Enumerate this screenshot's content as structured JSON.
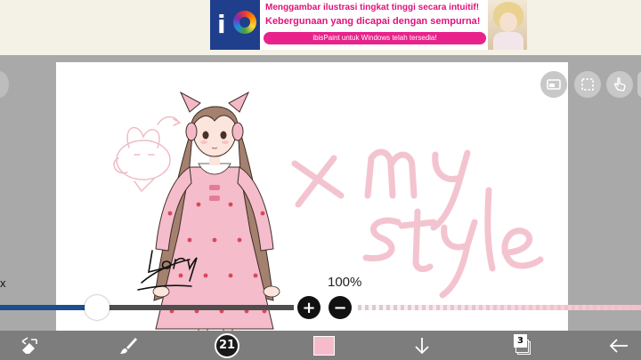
{
  "ad": {
    "logo_text": "i",
    "line1": "Menggambar ilustrasi tingkat tinggi secara intuitif!",
    "line2": "Kebergunaan yang dicapai dengan sempurna!",
    "cta": "ibisPaint untuk Windows telah tersedia!"
  },
  "canvas": {
    "handwritten_text": [
      "x my",
      "style"
    ],
    "signature": "Lory"
  },
  "tools_top": {
    "toggle_view_icon": "toggle-view-icon",
    "selection_icon": "selection-icon",
    "touch_icon": "touch-icon"
  },
  "slider": {
    "caption": "x",
    "zoom": "100%",
    "brush_size_value": 0.33,
    "plus": "+",
    "minus": "−"
  },
  "toolbar": {
    "brush_size": "21",
    "layers_count": "3",
    "current_color": "#f6bccb"
  },
  "colors": {
    "accent_blue": "#1d4f8e",
    "text_pink": "#f3c4cf",
    "toolbar_gray": "#7d7d7d"
  }
}
